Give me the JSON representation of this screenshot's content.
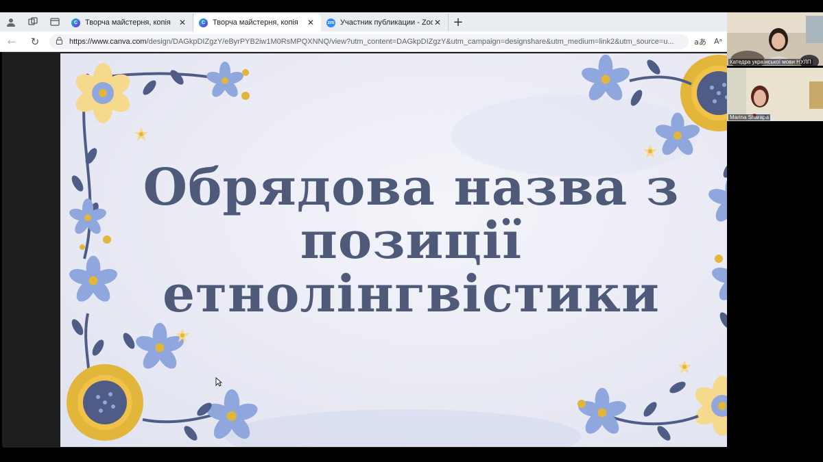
{
  "browser": {
    "tabs": [
      {
        "title": "Творча майстерня, копія",
        "favicon": "canva-icon",
        "active": false
      },
      {
        "title": "Творча майстерня, копія",
        "favicon": "canva-icon",
        "active": true
      },
      {
        "title": "Участник публикации - Zoom",
        "favicon": "zoom-icon",
        "active": false
      }
    ],
    "url_host": "https://www.canva.com",
    "url_rest": "/design/DAGkpDIZgzY/eByrPYB2iw1M0RsMPQXNNQ/view?utm_content=DAGkpDIZgzY&utm_campaign=designshare&utm_medium=link2&utm_source=u...",
    "read_aloud_label": "aあ",
    "reader_label": "Aᵃ"
  },
  "slide": {
    "title_lines": [
      "Обрядова назва з",
      "позиції",
      "етнолінгвістики"
    ],
    "colors": {
      "title": "#4f5a78",
      "flower_blue": "#8fa7dd",
      "flower_yellow": "#f5d98c",
      "sunflower": "#e2b53b",
      "leaf": "#4e5c86"
    }
  },
  "zoom": {
    "participants": [
      {
        "name": "Катедра української мови НУЛП"
      },
      {
        "name": "Marina Sharapa"
      }
    ]
  }
}
